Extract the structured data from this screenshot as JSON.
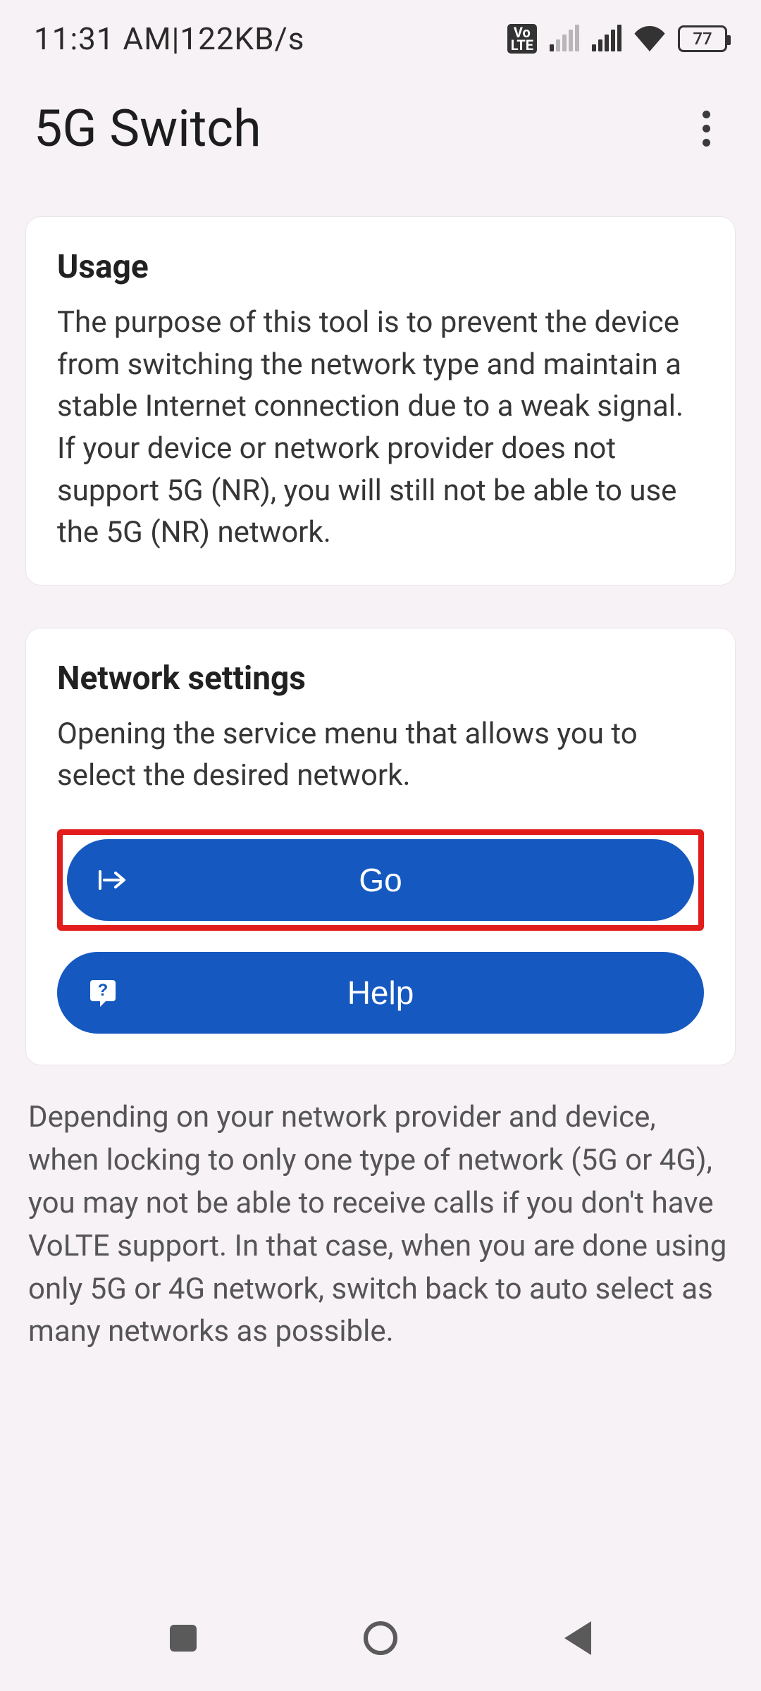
{
  "statusbar": {
    "time": "11:31 AM",
    "separator": " | ",
    "data_rate": "122KB/s",
    "battery_percent": "77"
  },
  "header": {
    "title": "5G Switch"
  },
  "cards": {
    "usage": {
      "title": "Usage",
      "body": "The purpose of this tool is to prevent the device from switching the network type and maintain a stable Internet connection due to a weak signal. If your device or network provider does not support 5G (NR), you will still not be able to use the 5G (NR) network."
    },
    "network": {
      "title": "Network settings",
      "body": "Opening the service menu that allows you to select the desired network.",
      "go_label": "Go",
      "help_label": "Help"
    }
  },
  "footer_note": "Depending on your network provider and device, when locking to only one type of network (5G or 4G), you may not be able to receive calls if you don't have VoLTE support. In that case, when you are done using only 5G or 4G network, switch back to auto select as many networks as possible.",
  "colors": {
    "primary": "#1559c0",
    "highlight_border": "#e21b1b",
    "background": "#f7f2f5"
  }
}
